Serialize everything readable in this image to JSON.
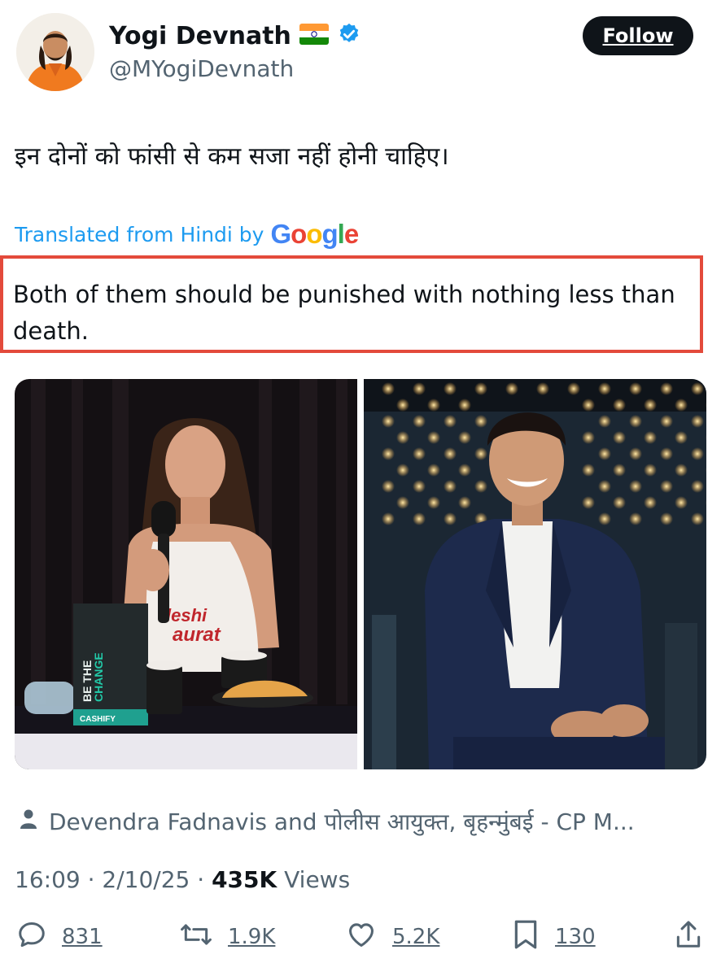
{
  "author": {
    "display_name": "Yogi Devnath",
    "handle": "@MYogiDevnath",
    "flag_emoji": "🇮🇳",
    "verified_icon": "verified-badge-icon"
  },
  "follow_button": {
    "label": "Follow"
  },
  "post": {
    "hindi_text": "इन दोनों को फांसी से कम सजा नहीं होनी चाहिए।",
    "translated_prefix": "Translated from Hindi by",
    "translator": "Google",
    "translation": "Both of them should be punished with nothing less than death."
  },
  "media": {
    "left_photo_text": [
      "BE THE",
      "CHANGE",
      "CASHIFY",
      "leshi",
      "aurat"
    ]
  },
  "tags": {
    "icon": "person-icon",
    "text": "Devendra Fadnavis and पोलीस आयुक्त, बृहन्मुंबई - CP M..."
  },
  "meta": {
    "time": "16:09",
    "date": "2/10/25",
    "views_count": "435K",
    "views_label": "Views"
  },
  "actions": {
    "replies": "831",
    "reposts": "1.9K",
    "likes": "5.2K",
    "bookmarks": "130"
  },
  "colors": {
    "link_blue": "#1d9bf0",
    "highlight_red": "#e34a3b",
    "text_primary": "#0f1419",
    "text_secondary": "#536471"
  }
}
